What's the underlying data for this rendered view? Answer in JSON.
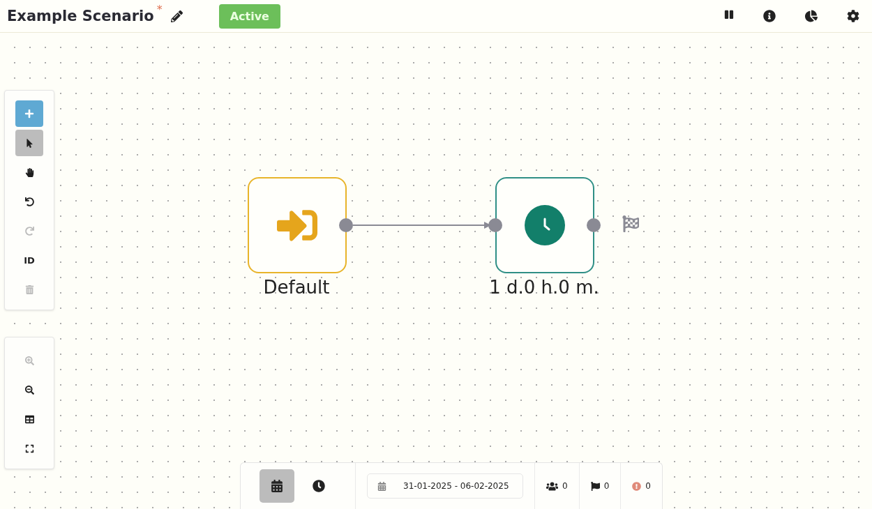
{
  "header": {
    "title": "Example Scenario",
    "modified_mark": "*",
    "status": "Active"
  },
  "tools": [
    {
      "kind": "add",
      "selected": false,
      "disabled": false
    },
    {
      "kind": "select",
      "selected": true,
      "disabled": false
    },
    {
      "kind": "pan",
      "selected": false,
      "disabled": false
    },
    {
      "kind": "undo",
      "selected": false,
      "disabled": false
    },
    {
      "kind": "redo",
      "selected": false,
      "disabled": true
    },
    {
      "kind": "id",
      "label": "ID",
      "selected": false,
      "disabled": false
    },
    {
      "kind": "delete",
      "selected": false,
      "disabled": true
    }
  ],
  "zoom_tools": [
    {
      "kind": "zoom-in",
      "disabled": true
    },
    {
      "kind": "zoom-out",
      "disabled": false
    },
    {
      "kind": "grid",
      "disabled": false
    },
    {
      "kind": "fullscreen",
      "disabled": false
    }
  ],
  "nodes": [
    {
      "kind": "start",
      "label": "Default"
    },
    {
      "kind": "timer",
      "label": "1 d.0 h.0 m."
    }
  ],
  "bottom_bar": {
    "views": [
      {
        "kind": "calendar",
        "selected": true
      },
      {
        "kind": "clock",
        "selected": false
      }
    ],
    "date_range": "31-01-2025 - 06-02-2025",
    "counters": [
      {
        "kind": "participants",
        "value": "0"
      },
      {
        "kind": "goals",
        "value": "0"
      },
      {
        "kind": "errors",
        "value": "0"
      }
    ]
  }
}
